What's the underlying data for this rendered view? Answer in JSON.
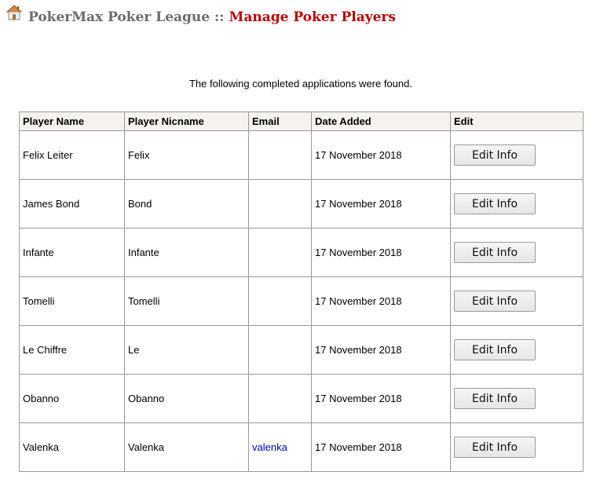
{
  "header": {
    "site_name": "PokerMax Poker League",
    "separator": "::",
    "page_name": "Manage Poker Players"
  },
  "intro_text": "The following completed applications were found.",
  "table": {
    "columns": [
      "Player Name",
      "Player Nicname",
      "Email",
      "Date Added",
      "Edit"
    ],
    "rows": [
      {
        "name": "Felix Leiter",
        "nickname": "Felix",
        "email": "",
        "date_added": "17 November 2018",
        "edit_label": "Edit Info"
      },
      {
        "name": "James Bond",
        "nickname": "Bond",
        "email": "",
        "date_added": "17 November 2018",
        "edit_label": "Edit Info"
      },
      {
        "name": "Infante",
        "nickname": "Infante",
        "email": "",
        "date_added": "17 November 2018",
        "edit_label": "Edit Info"
      },
      {
        "name": "Tomelli",
        "nickname": "Tomelli",
        "email": "",
        "date_added": "17 November 2018",
        "edit_label": "Edit Info"
      },
      {
        "name": "Le Chiffre",
        "nickname": "Le",
        "email": "",
        "date_added": "17 November 2018",
        "edit_label": "Edit Info"
      },
      {
        "name": "Obanno",
        "nickname": "Obanno",
        "email": "",
        "date_added": "17 November 2018",
        "edit_label": "Edit Info"
      },
      {
        "name": "Valenka",
        "nickname": "Valenka",
        "email": "valenka",
        "date_added": "17 November 2018",
        "edit_label": "Edit Info"
      }
    ]
  },
  "colors": {
    "page_title": "#c00000",
    "site_name": "#6b6b6b",
    "link": "#0000cc",
    "header_bg": "#f6f3ee",
    "border": "#999999"
  },
  "icons": {
    "home": "home-icon"
  }
}
